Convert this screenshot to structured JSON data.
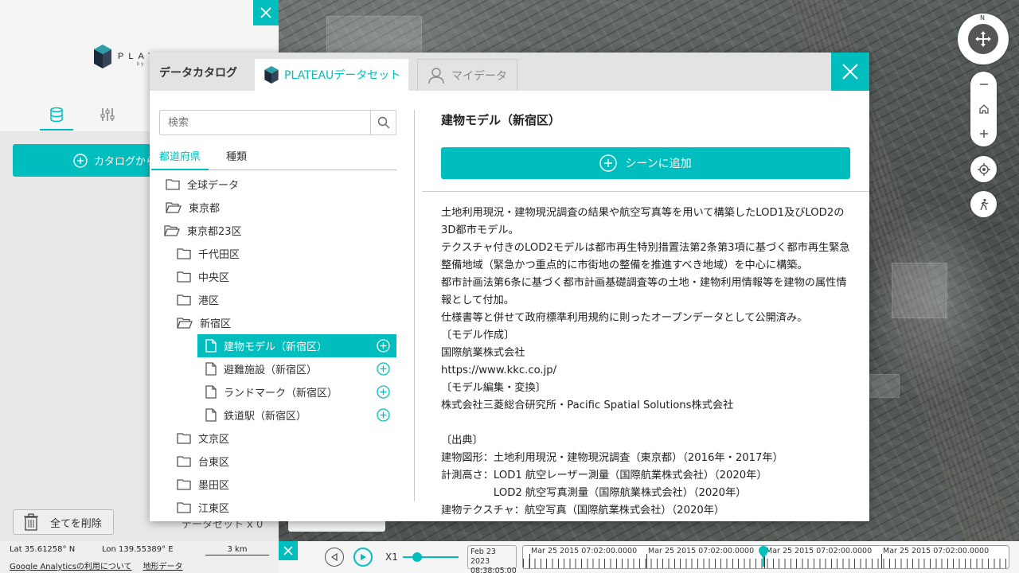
{
  "left_panel": {
    "logo_text": "PLATEAU",
    "logo_sub": "by",
    "catalog_button_label": "カタログから",
    "delete_all_label": "全てを削除",
    "dataset_count_label": "データセット x 0"
  },
  "status_bar": {
    "lat": "Lat  35.61258° N",
    "lon": "Lon  139.55389° E",
    "scale": "3 km",
    "analytics_link": "Google Analyticsの利用について",
    "terrain_link": "地形データ"
  },
  "timeline": {
    "speed": "X1",
    "date_line1": "Feb 23 2023",
    "date_line2": "08:38:05.00",
    "track_labels": [
      "Mar 25 2015 07:02:00.0000",
      "Mar 25 2015 07:02:00.0000",
      "Mar 25 2015 07:02:00.0000",
      "Mar 25 2015 07:02:00.0000"
    ]
  },
  "map_controls": {
    "compass_north": "N"
  },
  "modal": {
    "title": "データカタログ",
    "tabs": [
      {
        "label": "PLATEAUデータセット",
        "active": true
      },
      {
        "label": "マイデータ",
        "active": false
      }
    ],
    "search_placeholder": "検索",
    "filter_tabs": [
      {
        "label": "都道府県",
        "active": true
      },
      {
        "label": "種類",
        "active": false
      }
    ],
    "tree": [
      {
        "label": "全球データ",
        "type": "folder",
        "depth": 0,
        "open": false
      },
      {
        "label": "東京都",
        "type": "folder",
        "depth": 0,
        "open": true
      },
      {
        "label": "東京都23区",
        "type": "folder",
        "depth": 1,
        "open": true
      },
      {
        "label": "千代田区",
        "type": "folder",
        "depth": 2,
        "open": false
      },
      {
        "label": "中央区",
        "type": "folder",
        "depth": 2,
        "open": false
      },
      {
        "label": "港区",
        "type": "folder",
        "depth": 2,
        "open": false
      },
      {
        "label": "新宿区",
        "type": "folder",
        "depth": 2,
        "open": true
      },
      {
        "label": "建物モデル（新宿区）",
        "type": "file",
        "depth": 3,
        "selected": true
      },
      {
        "label": "避難施設（新宿区）",
        "type": "file",
        "depth": 3,
        "selected": false
      },
      {
        "label": "ランドマーク（新宿区）",
        "type": "file",
        "depth": 3,
        "selected": false
      },
      {
        "label": "鉄道駅（新宿区）",
        "type": "file",
        "depth": 3,
        "selected": false
      },
      {
        "label": "文京区",
        "type": "folder",
        "depth": 2,
        "open": false
      },
      {
        "label": "台東区",
        "type": "folder",
        "depth": 2,
        "open": false
      },
      {
        "label": "墨田区",
        "type": "folder",
        "depth": 2,
        "open": false
      },
      {
        "label": "江東区",
        "type": "folder",
        "depth": 2,
        "open": false
      }
    ],
    "detail": {
      "title": "建物モデル（新宿区）",
      "add_scene_label": "シーンに追加",
      "description": [
        "土地利用現況・建物現況調査の結果や航空写真等を用いて構築したLOD1及びLOD2の3D都市モデル。",
        "テクスチャ付きのLOD2モデルは都市再生特別措置法第2条第3項に基づく都市再生緊急整備地域（緊急かつ重点的に市街地の整備を推進すべき地域）を中心に構築。",
        "都市計画法第6条に基づく都市計画基礎調査等の土地・建物利用情報等を建物の属性情報として付加。",
        "仕様書等と併せて政府標準利用規約に則ったオープンデータとして公開済み。",
        "〔モデル作成〕",
        "国際航業株式会社",
        "https://www.kkc.co.jp/",
        "〔モデル編集・変換〕",
        "株式会社三菱総合研究所・Pacific Spatial Solutions株式会社",
        " ",
        "〔出典〕",
        "建物図形：土地利用現況・建物現況調査（東京都）（2016年・2017年）",
        "計測高さ：LOD1 航空レーザー測量（国際航業株式会社）（2020年）",
        "　　　　　LOD2 航空写真測量（国際航業株式会社）（2020年）",
        "建物テクスチャ：航空写真（国際航業株式会社）（2020年）"
      ]
    }
  },
  "colors": {
    "accent": "#00bebe"
  }
}
